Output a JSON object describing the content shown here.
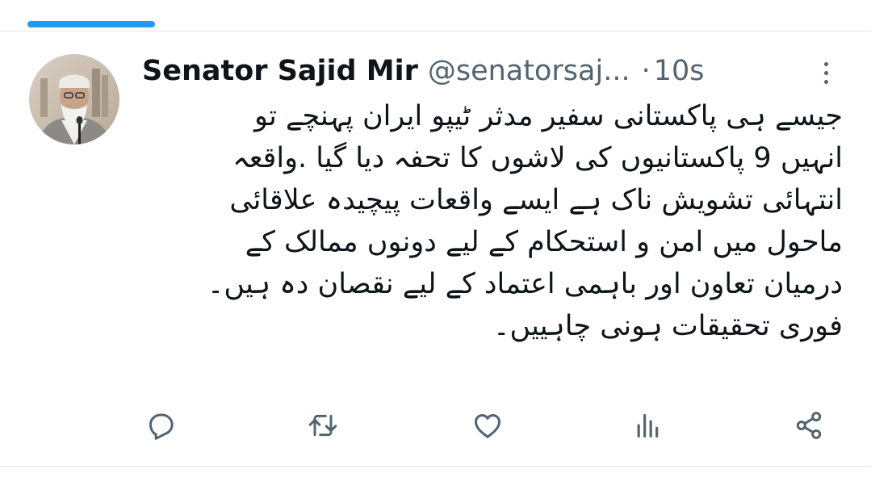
{
  "tweet": {
    "author_name": "Senator Sajid Mir",
    "handle": "@senatorsaj...",
    "separator": "·",
    "time": "10s",
    "body_lines": [
      "جیسے ہی  پاکستانی  سفیر مدثر ٹیپو ایران پہنچے  تو",
      "انہیں 9 پاکستانیوں  کی لاشوں کا تحفہ دیا گیا .واقعہ",
      "انتہائی تشویش ناک ہے ایسے واقعات پیچیدہ علاقائی",
      "ماحول میں امن و استحکام کے لیے دونوں ممالک کے",
      "درمیان تعاون اور باہمی اعتماد  کے لیے نقصان دہ ہیں۔",
      "فوری تحقیقات ہونی چاہییں۔"
    ]
  },
  "actions": {
    "icons": [
      "reply-icon",
      "retweet-icon",
      "like-icon",
      "views-icon",
      "share-icon"
    ]
  },
  "colors": {
    "accent": "#1d9bf0",
    "text": "#0f1419",
    "secondary": "#536471",
    "divider": "#e6e9ec"
  }
}
